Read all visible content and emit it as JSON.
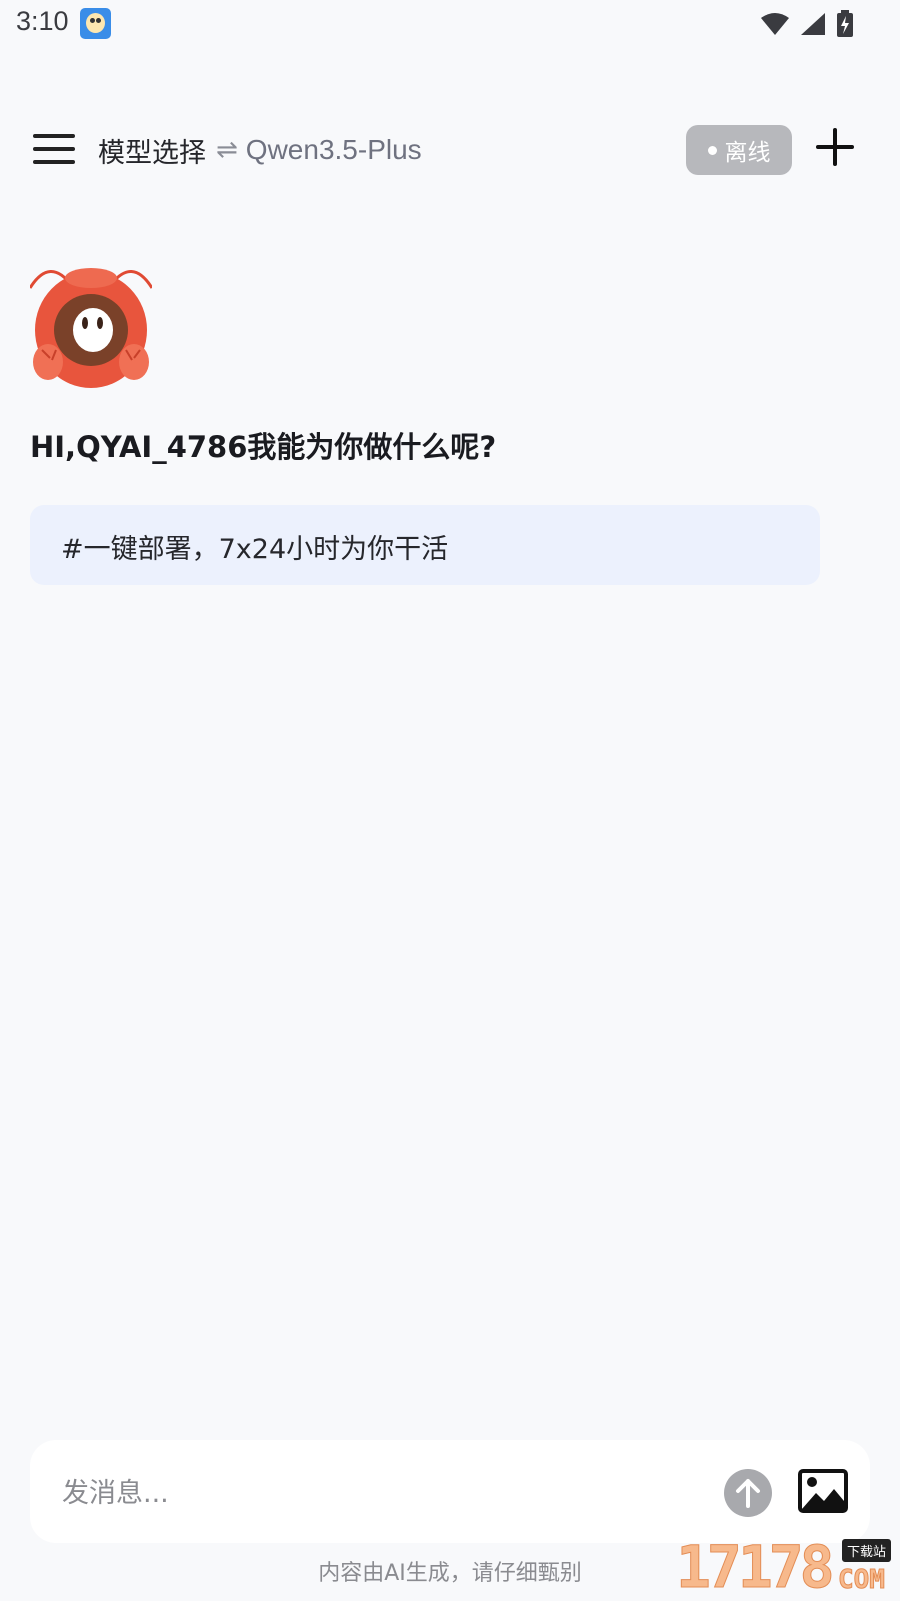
{
  "status_bar": {
    "time": "3:10",
    "app_icon": "cartoon-face-icon",
    "icons": [
      "wifi-icon",
      "signal-icon",
      "battery-charging-icon"
    ]
  },
  "header": {
    "menu_icon": "hamburger-menu-icon",
    "model_label": "模型选择",
    "swap_symbol": "⇌",
    "model_name": "Qwen3.5-Plus",
    "status_badge": "离线",
    "add_icon": "plus-icon"
  },
  "main": {
    "mascot_icon": "lobster-mascot-icon",
    "greeting": "HI,QYAI_4786我能为你做什么呢?",
    "suggestion": "#一键部署，7x24小时为你干活"
  },
  "input": {
    "placeholder": "发消息...",
    "send_icon": "arrow-up-icon",
    "image_icon": "image-icon"
  },
  "footer": {
    "disclaimer": "内容由AI生成，请仔细甄别"
  },
  "watermark": {
    "digits": "17178",
    "tag": "下载站",
    "suffix": "COM"
  },
  "colors": {
    "background": "#f8f9fb",
    "badge": "#b7b8bc",
    "suggestion_bg": "#ecf1fd",
    "send_button": "#a8a9ad",
    "mascot_red": "#e8553d"
  }
}
